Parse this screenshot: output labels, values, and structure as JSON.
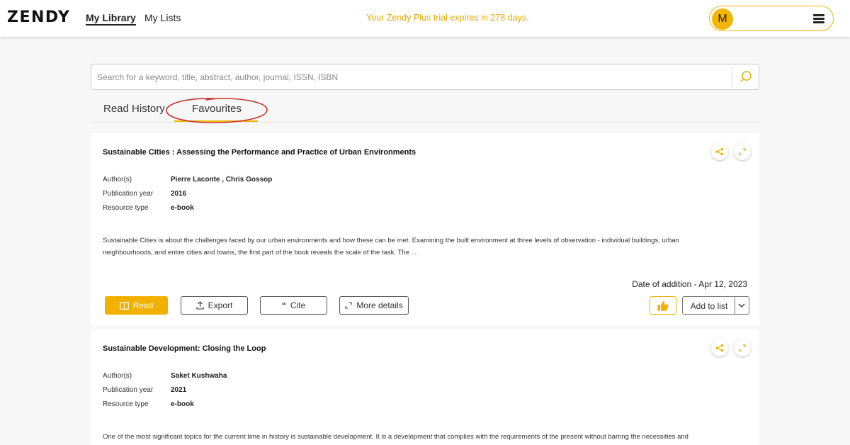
{
  "header": {
    "logo": "ZENDY",
    "nav": [
      {
        "label": "My Library",
        "active": true
      },
      {
        "label": "My Lists",
        "active": false
      }
    ],
    "trial_notice": "Your Zendy Plus trial expires in 278 days.",
    "avatar_initial": "M",
    "menu_icon": "hamburger-icon"
  },
  "search": {
    "placeholder": "Search for a keyword, title, abstract, author, journal, ISSN, ISBN",
    "value": "",
    "icon": "search-icon"
  },
  "tabs": [
    {
      "label": "Read History",
      "active": false
    },
    {
      "label": "Favourites",
      "active": true
    }
  ],
  "meta_labels": {
    "authors": "Author(s)",
    "year": "Publication year",
    "type": "Resource type"
  },
  "results": [
    {
      "title": "Sustainable Cities : Assessing the Performance and Practice of Urban Environments",
      "authors": "Pierre Laconte , Chris Gossop",
      "year": "2016",
      "type": "e-book",
      "abstract_line1": "Sustainable Cities is about the challenges faced by our urban environments and how these can be met. Examining the built environment at three levels of observation - individual buildings, urban",
      "abstract_line2": "neighbourhoods, and entire cities and towns, the first part of the book reveals the scale of the task. The ...",
      "date_added": "Date of addition - Apr 12, 2023",
      "actions": {
        "read": "Read",
        "export": "Export",
        "cite": "Cite",
        "more": "More details",
        "add_to_list": "Add to list"
      }
    },
    {
      "title": "Sustainable Development: Closing the Loop",
      "authors": "Saket Kushwaha",
      "year": "2021",
      "type": "e-book",
      "abstract_line1": "One of the most significant topics for the current time in history is sustainable development. It is a development that complies with the requirements of the present without barring the necessities and"
    }
  ],
  "colors": {
    "accent": "#f2b000",
    "trial_text": "#e6a700",
    "annotation": "#c8322a"
  }
}
